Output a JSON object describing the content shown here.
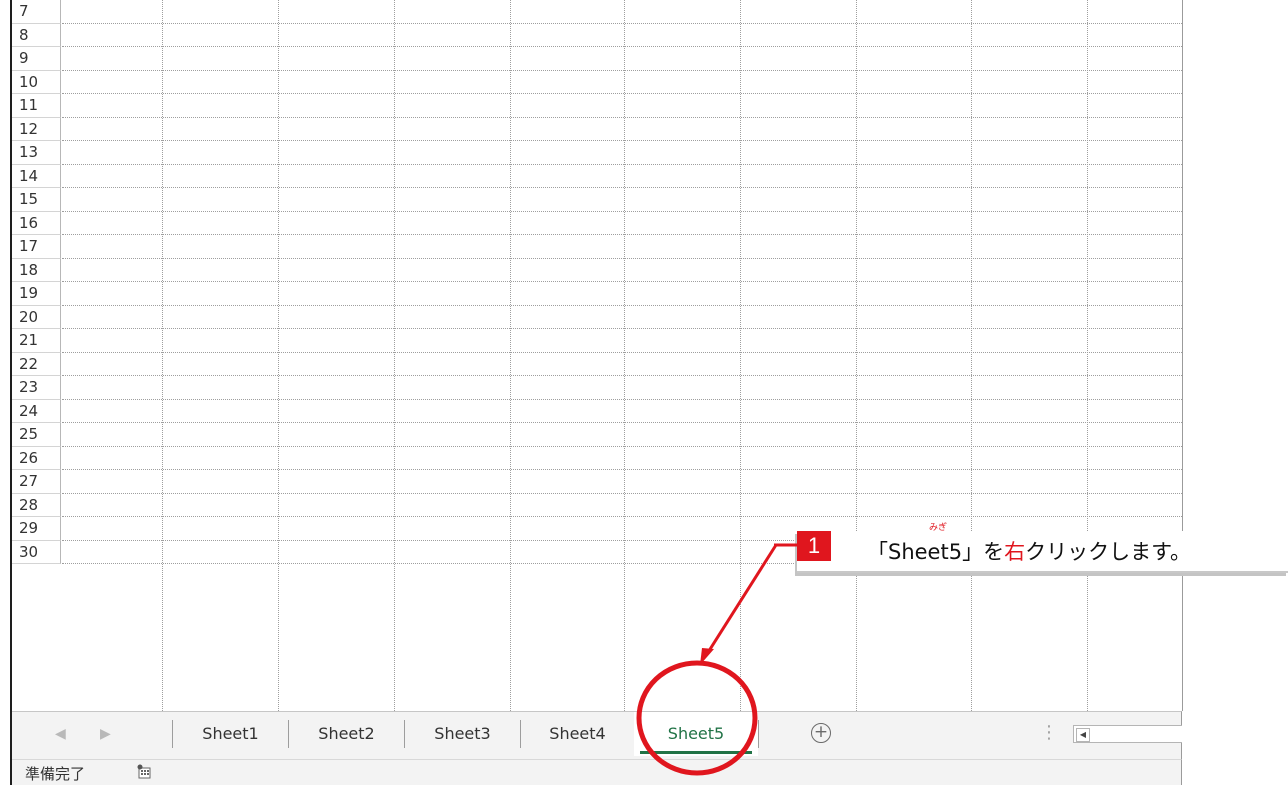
{
  "grid": {
    "row_numbers": [
      "7",
      "8",
      "9",
      "10",
      "11",
      "12",
      "13",
      "14",
      "15",
      "16",
      "17",
      "18",
      "19",
      "20",
      "21",
      "22",
      "23",
      "24",
      "25",
      "26",
      "27",
      "28",
      "29",
      "30"
    ]
  },
  "tabbar": {
    "nav_prev": "◀",
    "nav_next": "▶",
    "tabs": [
      "Sheet1",
      "Sheet2",
      "Sheet3",
      "Sheet4",
      "Sheet5"
    ],
    "active_tab": "Sheet5",
    "add_label": "+",
    "dots": "⋮",
    "scroll_left": "◀"
  },
  "status": {
    "text": "準備完了"
  },
  "callout": {
    "number": "1",
    "text_before": "「Sheet5」を",
    "highlight": "右",
    "text_after": "クリックします。",
    "ruby": "みぎ"
  },
  "colors": {
    "accent_red": "#e0161e",
    "active_tab_green": "#217346"
  }
}
